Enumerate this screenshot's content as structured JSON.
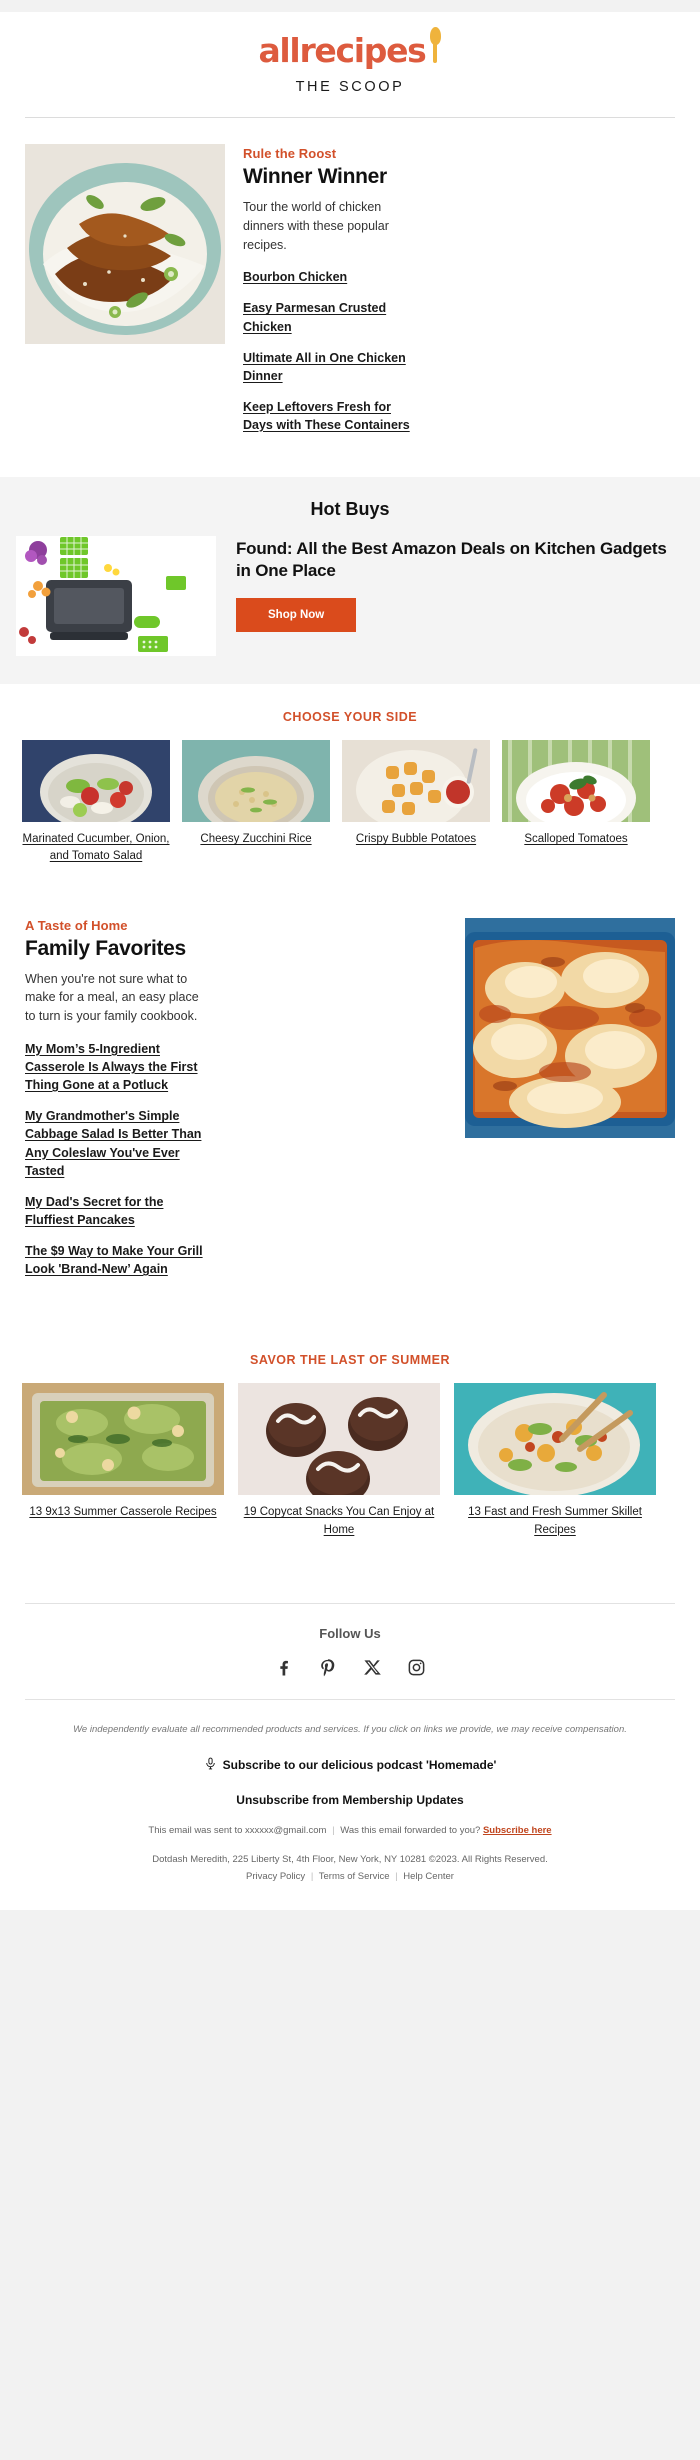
{
  "brand": {
    "logo_text": "allrecipes",
    "tagline": "THE SCOOP",
    "accent_color": "#DD5B3E",
    "spoon_color": "#EFB33C",
    "button_color": "#DA4B1C"
  },
  "feature": {
    "eyebrow": "Rule the Roost",
    "headline": "Winner Winner",
    "dek": "Tour the world of chicken dinners with these popular recipes.",
    "image_alt": "glazed chicken thighs over rice with scallions",
    "links": [
      "Bourbon Chicken",
      "Easy Parmesan Crusted Chicken",
      "Ultimate All in One Chicken Dinner",
      "Keep Leftovers Fresh for Days with These Containers"
    ]
  },
  "hot_buys": {
    "title": "Hot Buys",
    "headline": "Found: All the Best Amazon Deals on Kitchen Gadgets in One Place",
    "cta_label": "Shop Now",
    "image_alt": "vegetable chopper kitchen gadget with colorful diced vegetables"
  },
  "choose_your_side": {
    "kicker": "CHOOSE YOUR SIDE",
    "cards": [
      {
        "caption": "Marinated Cucumber, Onion, and Tomato Salad",
        "image_alt": "cucumber tomato onion salad in bowl on blue cloth"
      },
      {
        "caption": "Cheesy Zucchini Rice",
        "image_alt": "cheesy zucchini rice in a speckled bowl"
      },
      {
        "caption": "Crispy Bubble Potatoes",
        "image_alt": "crispy bubble potatoes on plate with ketchup"
      },
      {
        "caption": "Scalloped Tomatoes",
        "image_alt": "scalloped tomatoes with basil in white dish"
      }
    ]
  },
  "taste_of_home": {
    "eyebrow": "A Taste of Home",
    "headline": "Family Favorites",
    "dek": "When you're not sure what to make for a meal, an easy place to turn is your family cookbook.",
    "image_alt": "cheesy baked lasagna in a blue casserole dish",
    "links": [
      "My Mom’s 5-Ingredient Casserole Is Always the First Thing Gone at a Potluck",
      "My Grandmother's Simple Cabbage Salad Is Better Than Any Coleslaw You've Ever Tasted",
      "My Dad's Secret for the Fluffiest Pancakes",
      "The $9 Way to Make Your Grill Look 'Brand-New’ Again"
    ]
  },
  "savor": {
    "kicker": "SAVOR THE LAST OF SUMMER",
    "cards": [
      {
        "caption": "13 9x13 Summer Casserole Recipes",
        "image_alt": "green vegetable casserole in a glass baking dish"
      },
      {
        "caption": "19 Copycat Snacks You Can Enjoy at Home",
        "image_alt": "chocolate cupcakes with white icing squiggles"
      },
      {
        "caption": "13 Fast and Fresh Summer Skillet Recipes",
        "image_alt": "summer vegetable skillet with wooden spoons"
      }
    ]
  },
  "follow": {
    "title": "Follow Us",
    "socials": [
      {
        "name": "facebook-icon",
        "label": "Facebook"
      },
      {
        "name": "pinterest-icon",
        "label": "Pinterest"
      },
      {
        "name": "x-twitter-icon",
        "label": "X"
      },
      {
        "name": "instagram-icon",
        "label": "Instagram"
      }
    ]
  },
  "legal": {
    "disclaimer": "We independently evaluate all recommended products and services. If you click on links we provide, we may receive compensation.",
    "podcast": "Subscribe to our delicious podcast 'Homemade'",
    "unsubscribe": "Unsubscribe from Membership Updates",
    "sent_to_prefix": "This email was sent to xxxxxx@gmail.com",
    "forwarded_text": "Was this email forwarded to you?",
    "subscribe_link": "Subscribe here",
    "copyright": "Dotdash Meredith, 225 Liberty St, 4th Floor, New York, NY 10281 ©2023. All Rights Reserved.",
    "privacy": "Privacy Policy",
    "terms": "Terms of Service",
    "help": "Help Center"
  }
}
